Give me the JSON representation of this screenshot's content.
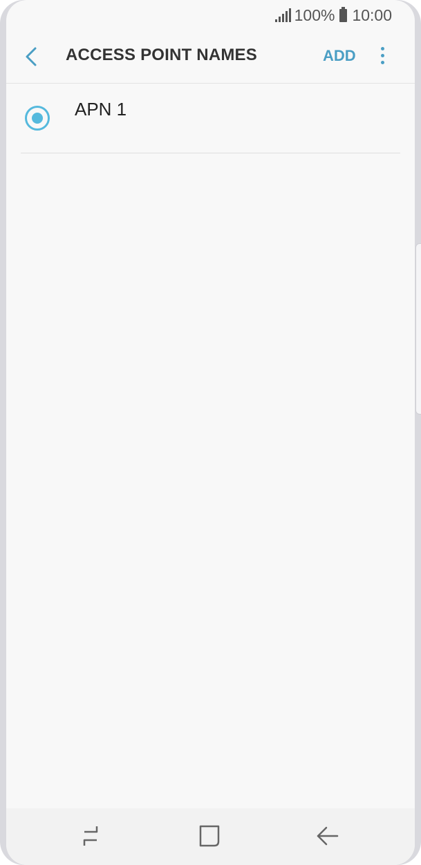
{
  "status_bar": {
    "battery": "100%",
    "time": "10:00",
    "icons": [
      "signal-icon",
      "battery-icon"
    ]
  },
  "app_bar": {
    "title": "ACCESS POINT NAMES",
    "add_label": "ADD",
    "icons": [
      "chevron-left-icon",
      "more-vert-icon"
    ]
  },
  "apn_list": {
    "items": [
      {
        "name": "APN 1",
        "selected": true
      }
    ]
  },
  "nav_bar": {
    "icons": [
      "recent-apps-icon",
      "home-icon",
      "back-arrow-icon"
    ]
  },
  "colors": {
    "accent": "#4a9ec4",
    "radio": "#55b9dd",
    "background": "#f8f8f8"
  }
}
